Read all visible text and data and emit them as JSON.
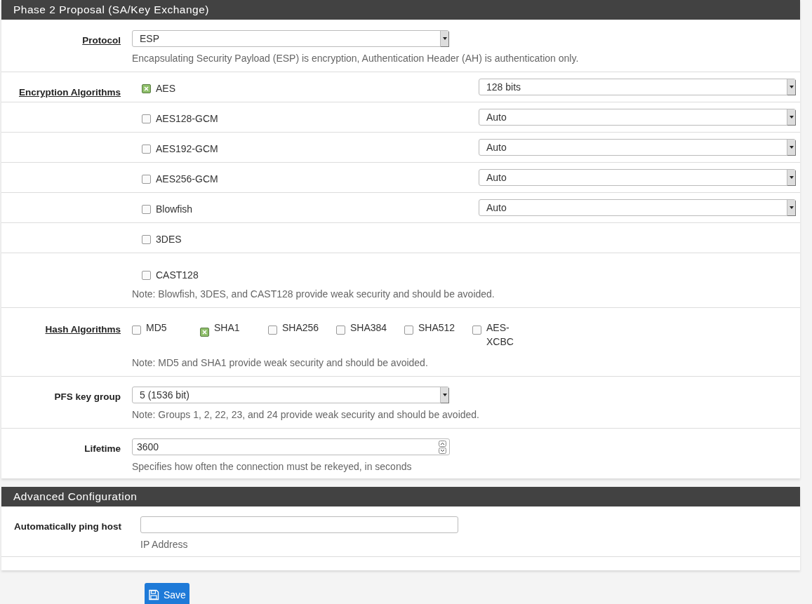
{
  "phase2": {
    "title": "Phase 2 Proposal (SA/Key Exchange)",
    "protocol": {
      "label": "Protocol",
      "link": true,
      "value": "ESP",
      "help": "Encapsulating Security Payload (ESP) is encryption, Authentication Header (AH) is authentication only."
    },
    "encryption": {
      "label": "Encryption Algorithms",
      "link": true,
      "algorithms": [
        {
          "name": "AES",
          "checked": true,
          "key_length": "128 bits"
        },
        {
          "name": "AES128-GCM",
          "checked": false,
          "key_length": "Auto"
        },
        {
          "name": "AES192-GCM",
          "checked": false,
          "key_length": "Auto"
        },
        {
          "name": "AES256-GCM",
          "checked": false,
          "key_length": "Auto"
        },
        {
          "name": "Blowfish",
          "checked": false,
          "key_length": "Auto"
        },
        {
          "name": "3DES",
          "checked": false
        },
        {
          "name": "CAST128",
          "checked": false
        }
      ],
      "note": "Note: Blowfish, 3DES, and CAST128 provide weak security and should be avoided."
    },
    "hash": {
      "label": "Hash Algorithms",
      "link": true,
      "algorithms": [
        {
          "name": "MD5",
          "checked": false
        },
        {
          "name": "SHA1",
          "checked": true
        },
        {
          "name": "SHA256",
          "checked": false
        },
        {
          "name": "SHA384",
          "checked": false
        },
        {
          "name": "SHA512",
          "checked": false
        },
        {
          "name": "AES-XCBC",
          "checked": false
        }
      ],
      "note": "Note: MD5 and SHA1 provide weak security and should be avoided."
    },
    "pfs": {
      "label": "PFS key group",
      "link": false,
      "value": "5 (1536 bit)",
      "note": "Note: Groups 1, 2, 22, 23, and 24 provide weak security and should be avoided."
    },
    "lifetime": {
      "label": "Lifetime",
      "link": false,
      "value": "3600",
      "help": "Specifies how often the connection must be rekeyed, in seconds"
    }
  },
  "advanced": {
    "title": "Advanced Configuration",
    "ping": {
      "label": "Automatically ping host",
      "link": false,
      "help": "IP Address"
    }
  },
  "save_button": "Save"
}
